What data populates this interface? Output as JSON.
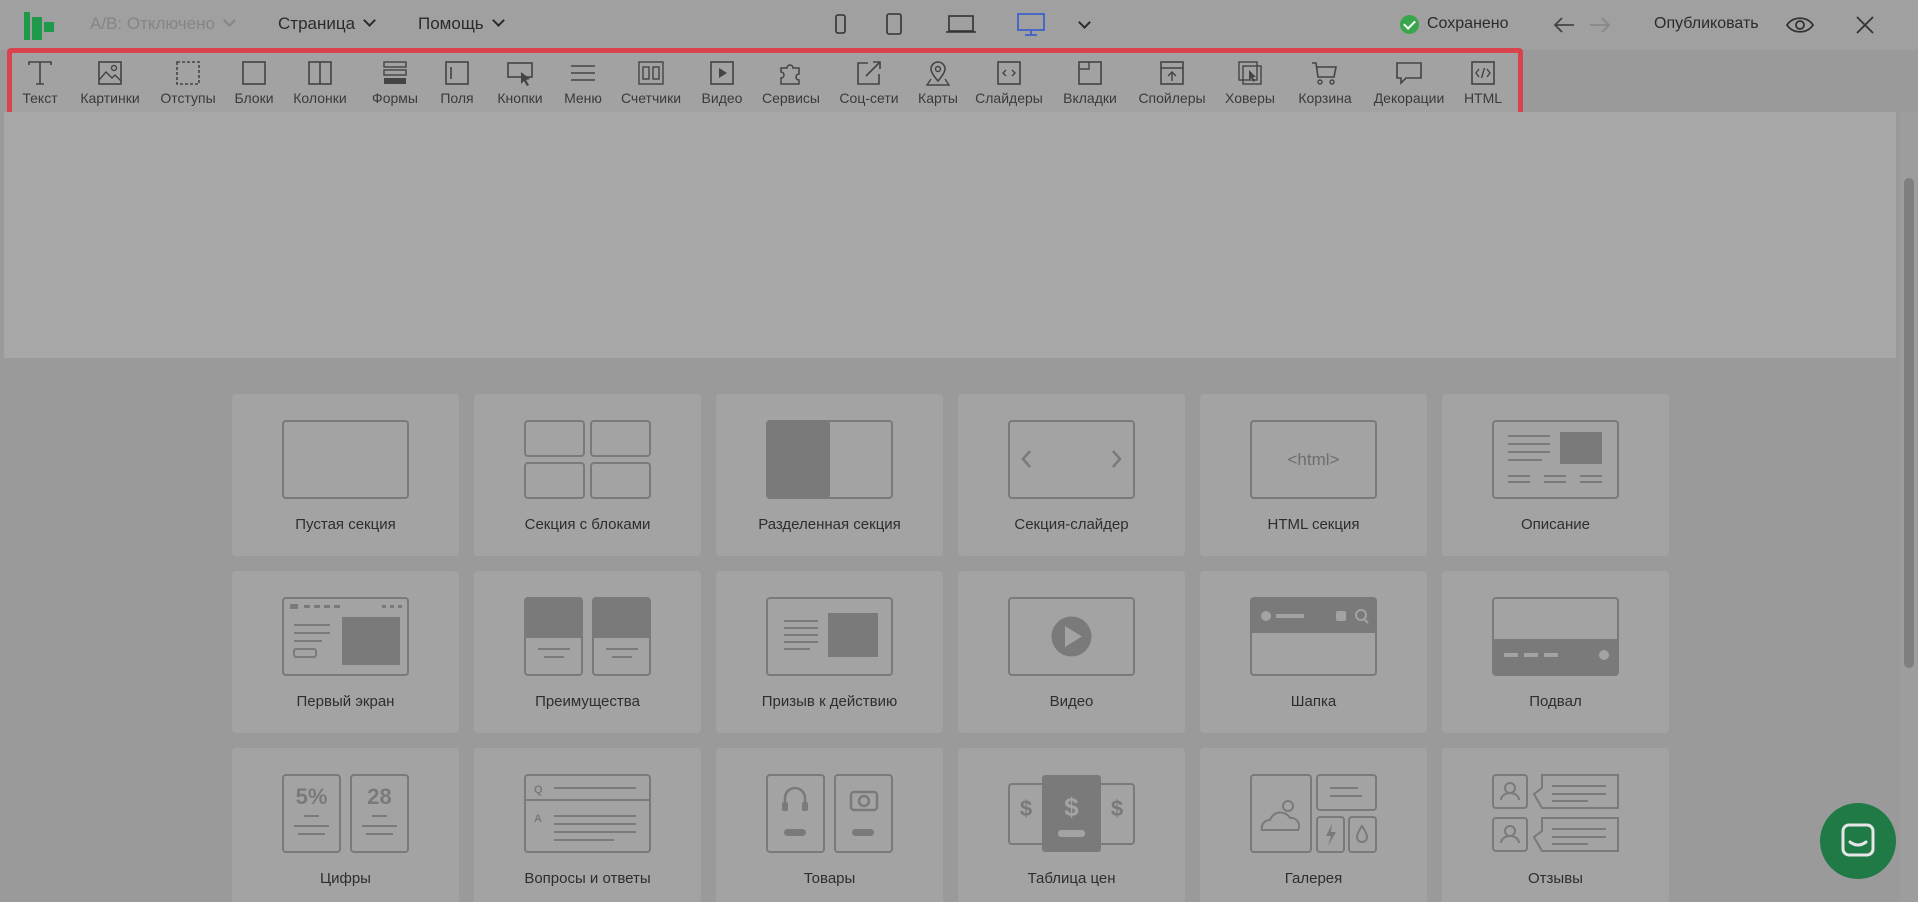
{
  "header": {
    "ab_test": "А/В: Отключено",
    "page_menu": "Страница",
    "help_menu": "Помощь",
    "status": "Сохранено",
    "publish": "Опубликовать"
  },
  "toolbar": {
    "items": [
      {
        "label": "Текст",
        "icon": "text-icon"
      },
      {
        "label": "Картинки",
        "icon": "image-icon"
      },
      {
        "label": "Отступы",
        "icon": "spacing-icon"
      },
      {
        "label": "Блоки",
        "icon": "block-icon"
      },
      {
        "label": "Колонки",
        "icon": "columns-icon"
      },
      {
        "label": "Формы",
        "icon": "form-icon"
      },
      {
        "label": "Поля",
        "icon": "field-icon"
      },
      {
        "label": "Кнопки",
        "icon": "button-icon"
      },
      {
        "label": "Меню",
        "icon": "menu-icon"
      },
      {
        "label": "Счетчики",
        "icon": "counter-icon"
      },
      {
        "label": "Видео",
        "icon": "video-icon"
      },
      {
        "label": "Сервисы",
        "icon": "puzzle-icon"
      },
      {
        "label": "Соц-сети",
        "icon": "share-icon"
      },
      {
        "label": "Карты",
        "icon": "map-pin-icon"
      },
      {
        "label": "Слайдеры",
        "icon": "slider-icon"
      },
      {
        "label": "Вкладки",
        "icon": "tabs-icon"
      },
      {
        "label": "Спойлеры",
        "icon": "spoiler-icon"
      },
      {
        "label": "Ховеры",
        "icon": "hover-icon"
      },
      {
        "label": "Корзина",
        "icon": "cart-icon"
      },
      {
        "label": "Декорации",
        "icon": "speech-bubble-icon"
      },
      {
        "label": "HTML",
        "icon": "html-code-icon"
      }
    ]
  },
  "sections": [
    {
      "label": "Пустая секция"
    },
    {
      "label": "Секция с блоками"
    },
    {
      "label": "Разделенная секция"
    },
    {
      "label": "Секция-слайдер"
    },
    {
      "label": "HTML секция",
      "thumb_text": "<html>"
    },
    {
      "label": "Описание"
    },
    {
      "label": "Первый экран"
    },
    {
      "label": "Преимущества"
    },
    {
      "label": "Призыв к действию"
    },
    {
      "label": "Видео"
    },
    {
      "label": "Шапка"
    },
    {
      "label": "Подвал"
    },
    {
      "label": "Цифры",
      "thumb_a": "5%",
      "thumb_b": "28"
    },
    {
      "label": "Вопросы и ответы",
      "thumb_a": "Q",
      "thumb_b": "A"
    },
    {
      "label": "Товары"
    },
    {
      "label": "Таблица цен",
      "thumb_a": "$"
    },
    {
      "label": "Галерея"
    },
    {
      "label": "Отзывы"
    }
  ],
  "colors": {
    "highlight": "#d9434d",
    "saved": "#3aa64b",
    "desktop_active": "#3e62c8",
    "chat": "#1f7a46",
    "logo": "#1f9a4a"
  }
}
